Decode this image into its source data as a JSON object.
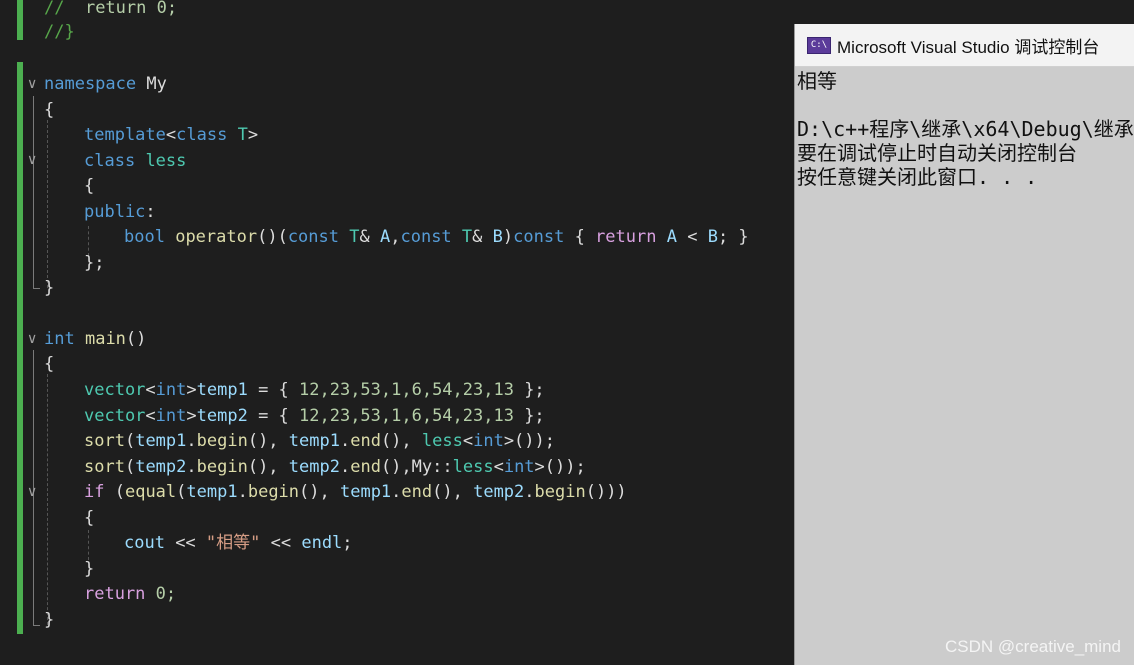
{
  "editor": {
    "code": {
      "l1": [
        "// ",
        " return 0;"
      ],
      "l2": [
        "//}"
      ],
      "l3": [
        "namespace",
        " My"
      ],
      "l4": [
        "{"
      ],
      "l5": [
        "template",
        "<",
        "class",
        " ",
        "T",
        ">"
      ],
      "l6": [
        "class",
        " ",
        "less"
      ],
      "l7": [
        "{"
      ],
      "l8": [
        "public",
        ":"
      ],
      "l9": [
        "bool",
        " ",
        "operator",
        "()(",
        "const",
        " ",
        "T",
        "& ",
        "A",
        ",",
        "const",
        " ",
        "T",
        "& ",
        "B",
        ")",
        "const",
        " { ",
        "return",
        " ",
        "A",
        " < ",
        "B",
        "; }"
      ],
      "l10": [
        "};"
      ],
      "l11": [
        "}"
      ],
      "l12": [
        "int",
        " ",
        "main",
        "()"
      ],
      "l13": [
        "{"
      ],
      "l14": [
        "vector",
        "<",
        "int",
        ">",
        "temp1",
        " = { ",
        "12,23,53,1,6,54,23,13",
        " };"
      ],
      "l15": [
        "vector",
        "<",
        "int",
        ">",
        "temp2",
        " = { ",
        "12,23,53,1,6,54,23,13",
        " };"
      ],
      "l16": [
        "sort",
        "(",
        "temp1",
        ".",
        "begin",
        "(), ",
        "temp1",
        ".",
        "end",
        "(), ",
        "less",
        "<",
        "int",
        ">());"
      ],
      "l17": [
        "sort",
        "(",
        "temp2",
        ".",
        "begin",
        "(), ",
        "temp2",
        ".",
        "end",
        "(),",
        "My",
        "::",
        "less",
        "<",
        "int",
        ">());"
      ],
      "l18": [
        "if",
        " (",
        "equal",
        "(",
        "temp1",
        ".",
        "begin",
        "(), ",
        "temp1",
        ".",
        "end",
        "(), ",
        "temp2",
        ".",
        "begin",
        "()))"
      ],
      "l19": [
        "{"
      ],
      "l20": [
        "cout",
        " << ",
        "\"相等\"",
        " << ",
        "endl",
        ";"
      ],
      "l21": [
        "}"
      ],
      "l22": [
        "return",
        " 0;"
      ],
      "l23": [
        "}"
      ]
    }
  },
  "console": {
    "title": "Microsoft Visual Studio 调试控制台",
    "icon_text": "C:\\",
    "lines": [
      "相等",
      "",
      "D:\\c++程序\\继承\\x64\\Debug\\继承",
      "要在调试停止时自动关闭控制台",
      "按任意键关闭此窗口. . ."
    ]
  },
  "watermark": "CSDN @creative_mind",
  "colors": {
    "editor_bg": "#1e1e1e",
    "keyword": "#569cd6",
    "type": "#4ec9b0",
    "function": "#dcdcaa",
    "variable": "#9cdcfe",
    "number": "#b5cea8",
    "string": "#d69d85",
    "change_bar": "#4caf50",
    "console_bg": "#cccccc"
  }
}
